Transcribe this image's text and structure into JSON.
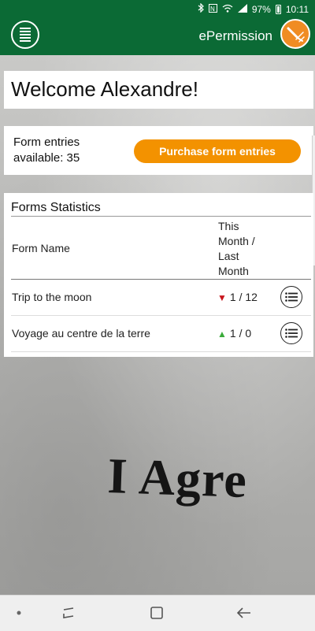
{
  "status_bar": {
    "battery": "97%",
    "time": "10:11",
    "icons": [
      "bluetooth-icon",
      "nfc-icon",
      "wifi-icon",
      "signal-icon",
      "battery-icon"
    ]
  },
  "app_bar": {
    "title": "ePermission",
    "brand_color": "#0b6a35",
    "accent_color": "#f39200",
    "icons": [
      "menu-icon",
      "app-logo-icon"
    ]
  },
  "welcome": {
    "text": "Welcome Alexandre!"
  },
  "entries": {
    "label_line1": "Form entries",
    "label_line2": "available: 35",
    "purchase_label": "Purchase form entries"
  },
  "stats": {
    "title": "Forms Statistics",
    "columns": {
      "name": "Form Name",
      "stat_line1": "This",
      "stat_line2": "Month /",
      "stat_line3": "Last",
      "stat_line4": "Month"
    },
    "rows": [
      {
        "name": "Trip to the moon",
        "trend": "down",
        "value": "1 / 12"
      },
      {
        "name": "Voyage au centre de la terre",
        "trend": "up",
        "value": "1 / 0"
      }
    ]
  },
  "background_text": "I Agre",
  "nav_bar": {
    "icons": [
      "dot-icon",
      "recent-apps-icon",
      "home-icon",
      "back-icon"
    ]
  }
}
